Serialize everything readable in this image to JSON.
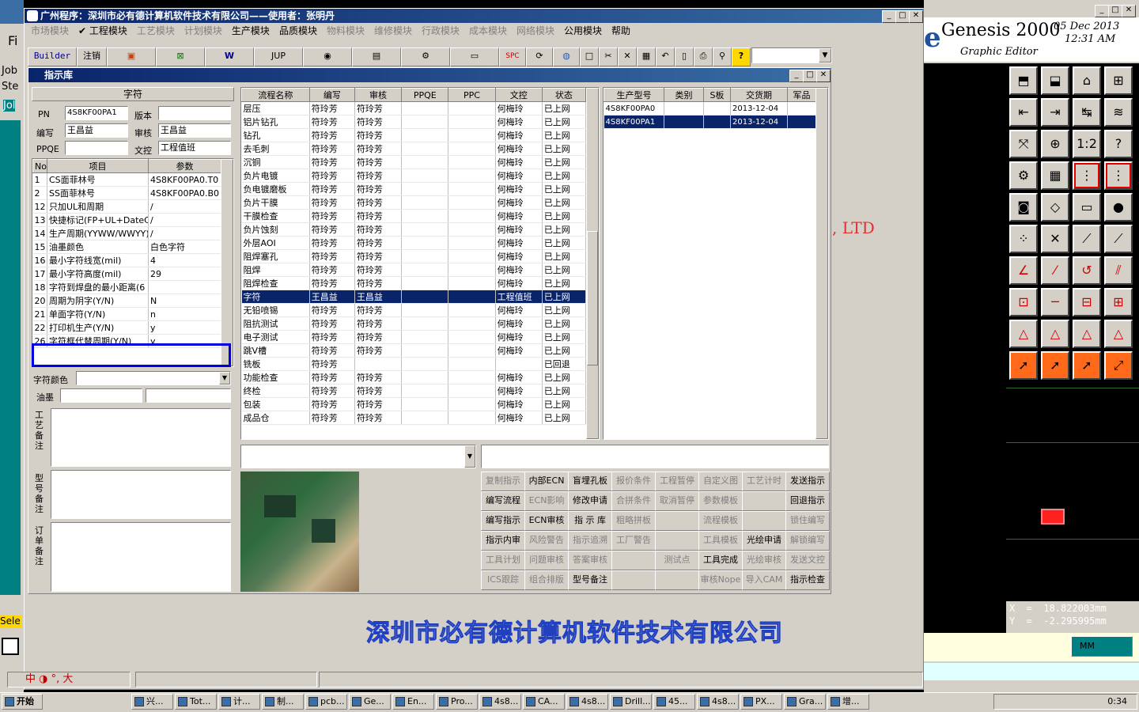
{
  "left_strip": {
    "lbl_fi": "Fi",
    "lbl_job1": "Job",
    "lbl_ste": "Ste",
    "lbl_job2": "Jol",
    "lbl_sel": "Sele"
  },
  "main_window": {
    "title": "广州程序：深圳市必有德计算机软件技术有限公司——使用者：张明丹",
    "menu": [
      {
        "label": "市场模块",
        "enabled": false
      },
      {
        "label": "✔ 工程模块",
        "enabled": true
      },
      {
        "label": "工艺模块",
        "enabled": false
      },
      {
        "label": "计划模块",
        "enabled": false
      },
      {
        "label": "生产模块",
        "enabled": true
      },
      {
        "label": "品质模块",
        "enabled": true
      },
      {
        "label": "物料模块",
        "enabled": false
      },
      {
        "label": "维修模块",
        "enabled": false
      },
      {
        "label": "行政模块",
        "enabled": false
      },
      {
        "label": "成本模块",
        "enabled": false
      },
      {
        "label": "网络模块",
        "enabled": false
      },
      {
        "label": "公用模块",
        "enabled": true
      },
      {
        "label": "帮助",
        "enabled": true
      }
    ],
    "toolbar": {
      "builder": "Builder",
      "logout": "注销",
      "jup": "JUP",
      "spc": "SPC"
    },
    "status_ime": "中 ◑ °, 大"
  },
  "dialog": {
    "title": "指示库",
    "section_header": "字符",
    "fields": {
      "pn_label": "PN",
      "pn_value": "4S8KF00PA1",
      "version_label": "版本",
      "version_value": "",
      "writer_label": "编写",
      "writer_value": "王昌益",
      "reviewer_label": "审核",
      "reviewer_value": "王昌益",
      "ppqe_label": "PPQE",
      "ppqe_value": "",
      "doc_label": "文控",
      "doc_value": "工程值班"
    },
    "param_table": {
      "headers": [
        "No",
        "项目",
        "参数"
      ],
      "rows": [
        [
          "1",
          "CS面菲林号",
          "4S8KF00PA0.T0"
        ],
        [
          "2",
          "SS面菲林号",
          "4S8KF00PA0.B0"
        ],
        [
          "12",
          "只加UL和周期",
          "/"
        ],
        [
          "13",
          "快捷标记(FP+UL+DateCo",
          "/"
        ],
        [
          "14",
          "生产周期(YYWW/WWYY)",
          "/"
        ],
        [
          "15",
          "油墨颜色",
          "白色字符"
        ],
        [
          "16",
          "最小字符线宽(mil)",
          "4"
        ],
        [
          "17",
          "最小字符高度(mil)",
          "29"
        ],
        [
          "18",
          "字符到焊盘的最小距离(6",
          ""
        ],
        [
          "20",
          "周期为阴字(Y/N)",
          "N"
        ],
        [
          "21",
          "单面字符(Y/N)",
          "n"
        ],
        [
          "22",
          "打印机生产(Y/N)",
          "y"
        ],
        [
          "26",
          "字符框代替周期(Y/N)",
          "y"
        ]
      ]
    },
    "char_color_label": "字符颜色",
    "ink_label": "油墨",
    "process_note_label": "工艺备注",
    "model_note_label": "型号备注",
    "order_note_label": "订单备注",
    "flow_table": {
      "headers": [
        "流程名称",
        "编写",
        "审核",
        "PPQE",
        "PPC",
        "文控",
        "状态"
      ],
      "rows": [
        [
          "层压",
          "符玲芳",
          "符玲芳",
          "",
          "",
          "何梅玲",
          "已上网"
        ],
        [
          "铝片钻孔",
          "符玲芳",
          "符玲芳",
          "",
          "",
          "何梅玲",
          "已上网"
        ],
        [
          "钻孔",
          "符玲芳",
          "符玲芳",
          "",
          "",
          "何梅玲",
          "已上网"
        ],
        [
          "去毛刺",
          "符玲芳",
          "符玲芳",
          "",
          "",
          "何梅玲",
          "已上网"
        ],
        [
          "沉铜",
          "符玲芳",
          "符玲芳",
          "",
          "",
          "何梅玲",
          "已上网"
        ],
        [
          "负片电镀",
          "符玲芳",
          "符玲芳",
          "",
          "",
          "何梅玲",
          "已上网"
        ],
        [
          "负电镀磨板",
          "符玲芳",
          "符玲芳",
          "",
          "",
          "何梅玲",
          "已上网"
        ],
        [
          "负片干膜",
          "符玲芳",
          "符玲芳",
          "",
          "",
          "何梅玲",
          "已上网"
        ],
        [
          "干膜检查",
          "符玲芳",
          "符玲芳",
          "",
          "",
          "何梅玲",
          "已上网"
        ],
        [
          "负片蚀刻",
          "符玲芳",
          "符玲芳",
          "",
          "",
          "何梅玲",
          "已上网"
        ],
        [
          "外层AOI",
          "符玲芳",
          "符玲芳",
          "",
          "",
          "何梅玲",
          "已上网"
        ],
        [
          "阻焊塞孔",
          "符玲芳",
          "符玲芳",
          "",
          "",
          "何梅玲",
          "已上网"
        ],
        [
          "阻焊",
          "符玲芳",
          "符玲芳",
          "",
          "",
          "何梅玲",
          "已上网"
        ],
        [
          "阻焊检查",
          "符玲芳",
          "符玲芳",
          "",
          "",
          "何梅玲",
          "已上网"
        ],
        [
          "字符",
          "王昌益",
          "王昌益",
          "",
          "",
          "工程值班",
          "已上网"
        ],
        [
          "无铅喷锡",
          "符玲芳",
          "符玲芳",
          "",
          "",
          "何梅玲",
          "已上网"
        ],
        [
          "阻抗测试",
          "符玲芳",
          "符玲芳",
          "",
          "",
          "何梅玲",
          "已上网"
        ],
        [
          "电子测试",
          "符玲芳",
          "符玲芳",
          "",
          "",
          "何梅玲",
          "已上网"
        ],
        [
          "跳V槽",
          "符玲芳",
          "符玲芳",
          "",
          "",
          "何梅玲",
          "已上网"
        ],
        [
          "铣板",
          "符玲芳",
          "",
          "",
          "",
          "",
          "已回退"
        ],
        [
          "功能检查",
          "符玲芳",
          "符玲芳",
          "",
          "",
          "何梅玲",
          "已上网"
        ],
        [
          "终检",
          "符玲芳",
          "符玲芳",
          "",
          "",
          "何梅玲",
          "已上网"
        ],
        [
          "包装",
          "符玲芳",
          "符玲芳",
          "",
          "",
          "何梅玲",
          "已上网"
        ],
        [
          "成品仓",
          "符玲芳",
          "符玲芳",
          "",
          "",
          "何梅玲",
          "已上网"
        ]
      ],
      "selected_index": 14
    },
    "model_table": {
      "headers": [
        "生产型号",
        "类别",
        "S板",
        "交货期",
        "军品"
      ],
      "rows": [
        [
          "4S8KF00PA0",
          "",
          "",
          "2013-12-04",
          ""
        ],
        [
          "4S8KF00PA1",
          "",
          "",
          "2013-12-04",
          ""
        ]
      ],
      "selected_index": 1
    },
    "buttons": [
      [
        {
          "l": "复制指示",
          "e": false
        },
        {
          "l": "内部ECN",
          "e": true
        },
        {
          "l": "盲埋孔板",
          "e": true
        },
        {
          "l": "报价条件",
          "e": false
        },
        {
          "l": "工程暂停",
          "e": false
        },
        {
          "l": "自定义图",
          "e": false
        },
        {
          "l": "工艺计时",
          "e": false
        },
        {
          "l": "发送指示",
          "e": true
        }
      ],
      [
        {
          "l": "编写流程",
          "e": true
        },
        {
          "l": "ECN影响",
          "e": false
        },
        {
          "l": "修改申请",
          "e": true
        },
        {
          "l": "合拼条件",
          "e": false
        },
        {
          "l": "取消暂停",
          "e": false
        },
        {
          "l": "参数模板",
          "e": false
        },
        {
          "l": "",
          "e": false
        },
        {
          "l": "回退指示",
          "e": true
        }
      ],
      [
        {
          "l": "编写指示",
          "e": true
        },
        {
          "l": "ECN审核",
          "e": true
        },
        {
          "l": "指 示 库",
          "e": true
        },
        {
          "l": "粗略拼板",
          "e": false
        },
        {
          "l": "",
          "e": false
        },
        {
          "l": "流程模板",
          "e": false
        },
        {
          "l": "",
          "e": false
        },
        {
          "l": "锁住编写",
          "e": false
        }
      ],
      [
        {
          "l": "指示内审",
          "e": true
        },
        {
          "l": "风险警告",
          "e": false
        },
        {
          "l": "指示追溯",
          "e": false
        },
        {
          "l": "工厂警告",
          "e": false
        },
        {
          "l": "",
          "e": false
        },
        {
          "l": "工具模板",
          "e": false
        },
        {
          "l": "光绘申请",
          "e": true
        },
        {
          "l": "解锁编写",
          "e": false
        }
      ],
      [
        {
          "l": "工具计划",
          "e": false
        },
        {
          "l": "问题审核",
          "e": false
        },
        {
          "l": "答案审核",
          "e": false
        },
        {
          "l": "",
          "e": false
        },
        {
          "l": "测试点",
          "e": false
        },
        {
          "l": "工具完成",
          "e": true
        },
        {
          "l": "光绘审核",
          "e": false
        },
        {
          "l": "发送文控",
          "e": false
        }
      ],
      [
        {
          "l": "ICS跟踪",
          "e": false
        },
        {
          "l": "组合排版",
          "e": false
        },
        {
          "l": "型号备注",
          "e": true
        },
        {
          "l": "",
          "e": false
        },
        {
          "l": "",
          "e": false
        },
        {
          "l": "审核Nope",
          "e": false
        },
        {
          "l": "导入CAM",
          "e": false
        },
        {
          "l": "指示检查",
          "e": true
        }
      ]
    ]
  },
  "company_banner": "深圳市必有德计算机软件技术有限公司",
  "ltd_text": ", LTD",
  "genesis": {
    "logo": "e",
    "title": "Genesis 2000",
    "date": "05 Dec 2013",
    "time": "12:31 AM",
    "subtitle": "Graphic Editor",
    "x_readout": "X  =  18.822003mm",
    "y_readout": "Y  =  -2.295995mm",
    "unit": "MM"
  },
  "taskbar": {
    "start": "开始",
    "tasks": [
      "兴...",
      "Tot...",
      "计...",
      "制...",
      "pcb...",
      "Ge...",
      "En...",
      "Pro...",
      "4s8...",
      "CA...",
      "4s8...",
      "Drill...",
      "45...",
      "4s8...",
      "PX...",
      "Gra...",
      "增..."
    ],
    "clock": "0:34"
  }
}
